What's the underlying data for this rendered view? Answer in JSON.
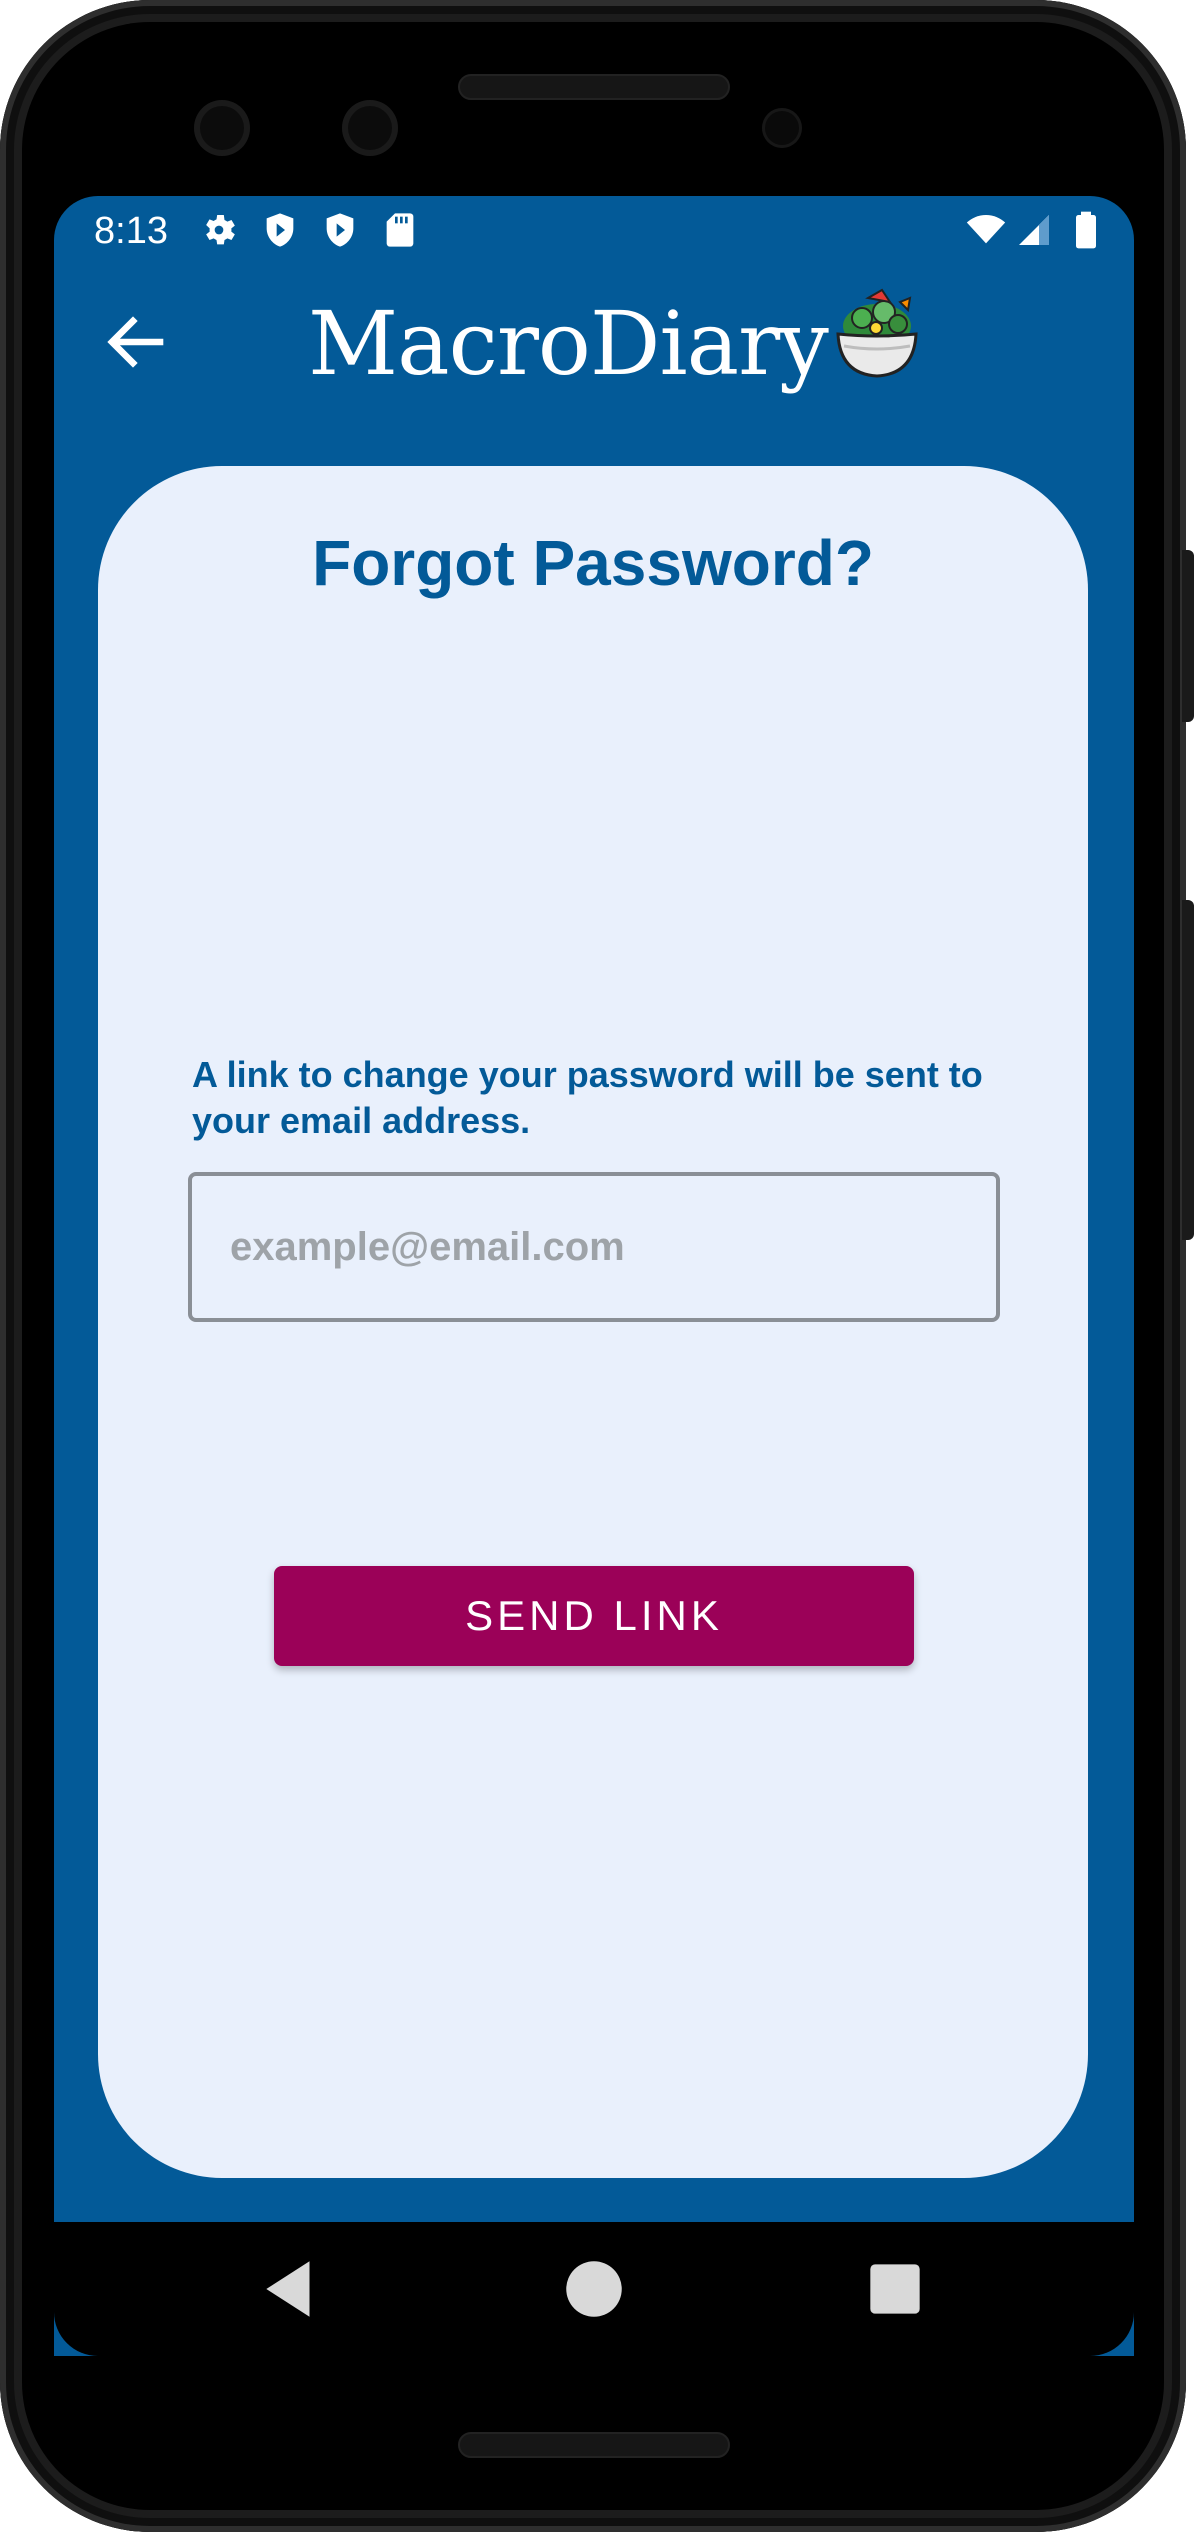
{
  "status_bar": {
    "time": "8:13",
    "left_icons": [
      "gear-icon",
      "shield-play-icon",
      "shield-play-icon",
      "sd-card-icon"
    ],
    "right_icons": [
      "wifi-icon",
      "signal-icon",
      "battery-icon"
    ]
  },
  "app_bar": {
    "title": "MacroDiary",
    "back_icon": "arrow-left-icon",
    "logo_icon": "salad-bowl-icon"
  },
  "card": {
    "title": "Forgot Password?",
    "info_text": "A link to change your password will be sent to your email address.",
    "email": {
      "value": "",
      "placeholder": "example@email.com"
    },
    "send_button_label": "SEND LINK"
  },
  "nav_bar": {
    "icons": [
      "back-triangle-icon",
      "home-circle-icon",
      "recents-square-icon"
    ]
  },
  "colors": {
    "primary": "#035a98",
    "card_background": "#e9f0fc",
    "accent": "#9b0158"
  }
}
